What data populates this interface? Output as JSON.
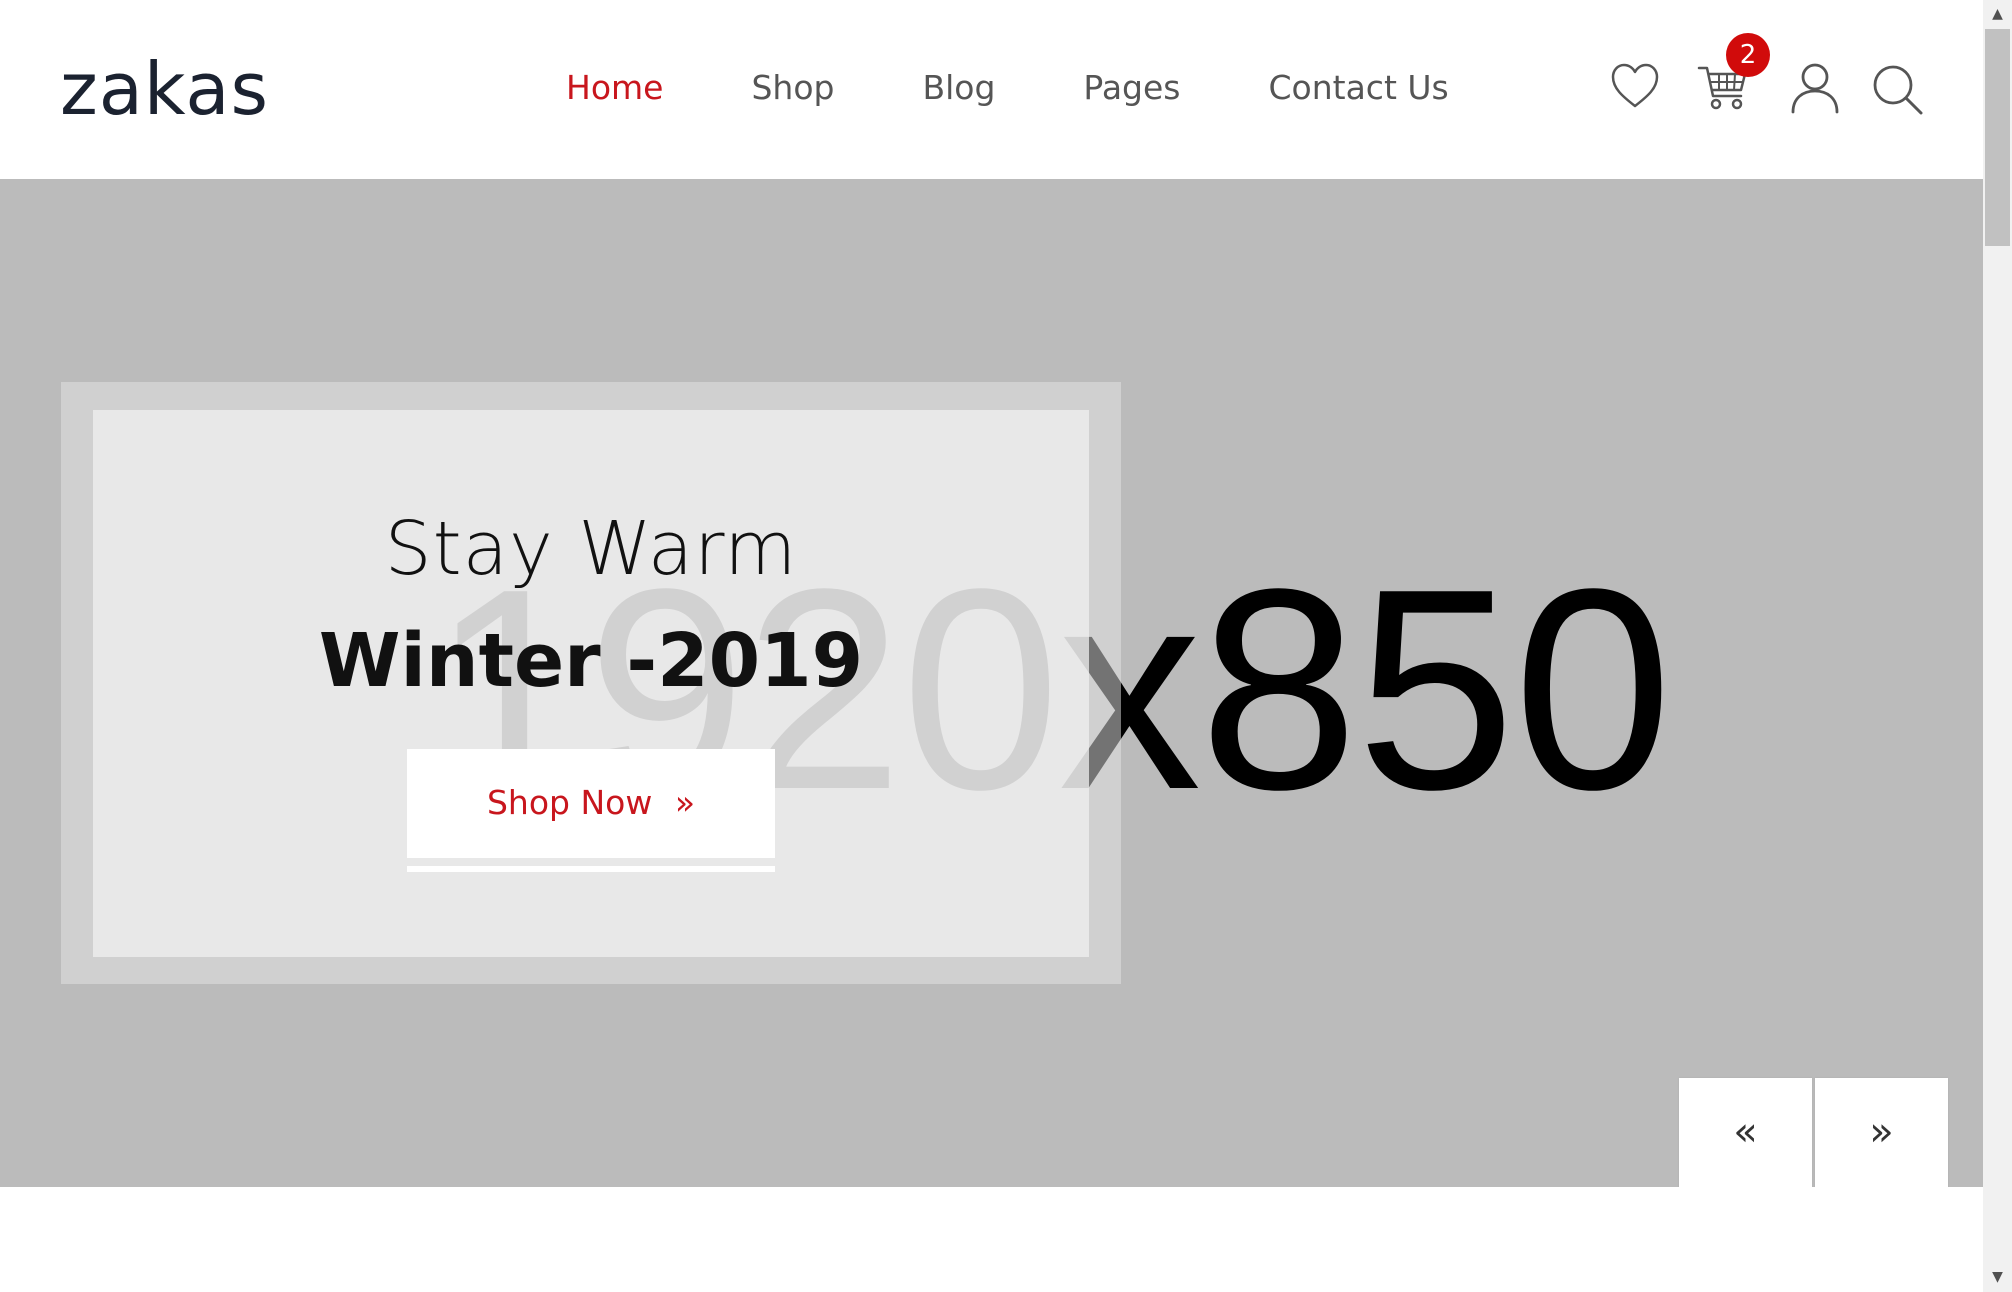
{
  "header": {
    "logo": "zakas",
    "nav": [
      {
        "label": "Home",
        "active": true
      },
      {
        "label": "Shop",
        "active": false
      },
      {
        "label": "Blog",
        "active": false
      },
      {
        "label": "Pages",
        "active": false
      },
      {
        "label": "Contact Us",
        "active": false
      }
    ],
    "icons": [
      "heart-icon",
      "cart-icon",
      "user-icon",
      "search-icon"
    ],
    "cart_count": "2"
  },
  "hero": {
    "placeholder": "1920x850",
    "subtitle": "Stay Warm",
    "title": "Winter -2019",
    "button_label": "Shop Now",
    "button_icon": "»",
    "prev_icon": "«",
    "next_icon": "»"
  },
  "colors": {
    "accent": "#c8161d",
    "badge": "#d10b0b",
    "hero_bg": "#bbbbbb",
    "logo": "#1b2230",
    "nav_text": "#555555"
  },
  "scrollbar": {
    "up_icon": "▲",
    "down_icon": "▼"
  }
}
